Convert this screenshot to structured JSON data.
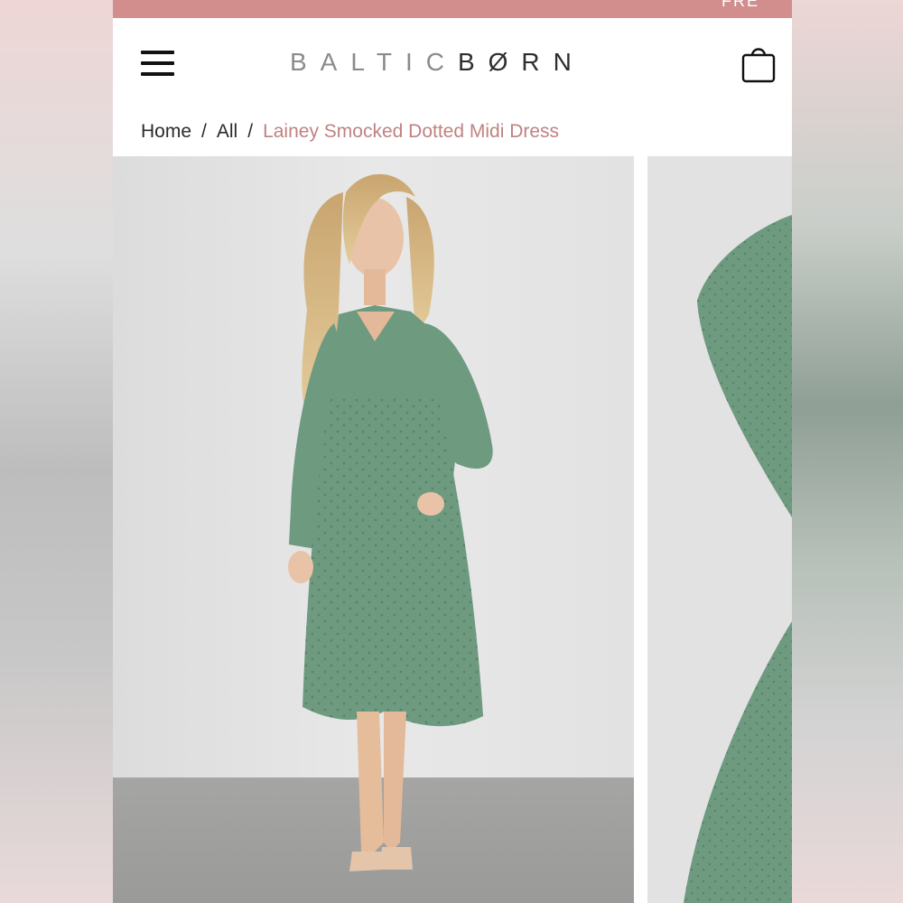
{
  "promo": {
    "text": "FRE"
  },
  "header": {
    "logo_light": "BALTIC",
    "logo_dark": "BØRN",
    "menu_icon": "hamburger-menu-icon",
    "cart_icon": "shopping-bag-icon"
  },
  "breadcrumb": {
    "items": [
      "Home",
      "All"
    ],
    "separator": "/",
    "current": "Lainey Smocked Dotted Midi Dress"
  },
  "colors": {
    "promo_bar": "#d28d8d",
    "breadcrumb_current": "#c08282",
    "dress_green": "#6e9a80"
  }
}
